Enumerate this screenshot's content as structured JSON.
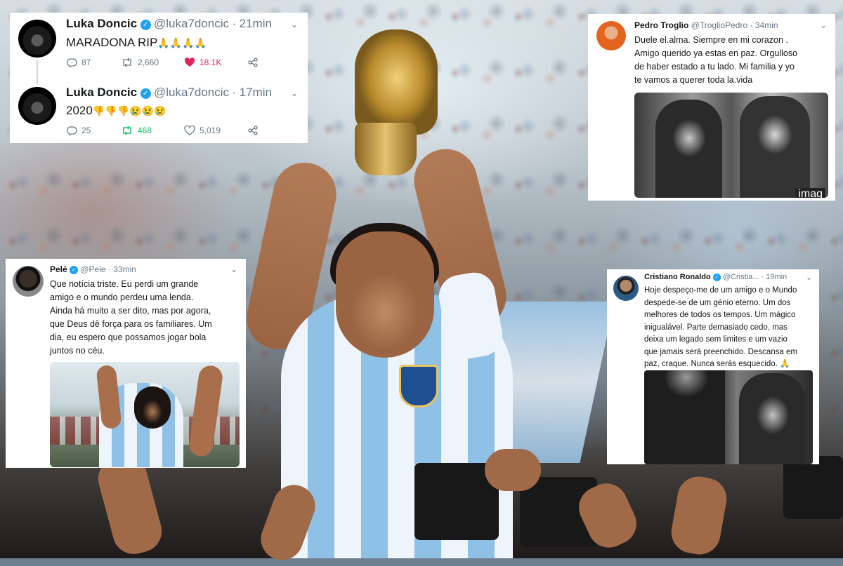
{
  "tweets": {
    "luka_1": {
      "name": "Luka Doncic",
      "handle": "@luka7doncic",
      "time": "21min",
      "text": "MARADONA RIP",
      "emoji": "🙏🙏🙏🙏",
      "replies": "87",
      "retweets": "2,660",
      "likes": "18.1K"
    },
    "luka_2": {
      "name": "Luka Doncic",
      "handle": "@luka7doncic",
      "time": "17min",
      "text": "2020",
      "emoji": "👎👎👎😢😢😢",
      "replies": "25",
      "retweets": "468",
      "likes": "5,019"
    },
    "troglio": {
      "name": "Pedro Troglio",
      "handle": "@TroglioPedro",
      "time": "34min",
      "lines": [
        "Duele el.alma. Siempre en mi corazon .",
        "Amigo querido ya estas en paz. Orgulloso",
        "de haber estado a tu lado. Mi familia y yo",
        "te vamos a querer toda la.vida"
      ],
      "photo_watermark": "imag"
    },
    "pele": {
      "name": "Pelé",
      "handle": "@Pele",
      "time": "33min",
      "lines": [
        "Que notícia triste. Eu perdi um grande",
        "amigo e o mundo perdeu uma lenda.",
        "Ainda há muito a ser dito, mas por agora,",
        "que Deus dê força para os familiares. Um",
        "dia, eu espero que possamos jogar bola",
        "juntos no céu."
      ]
    },
    "ronaldo": {
      "name": "Cristiano Ronaldo",
      "handle": "@Cristia...",
      "time": "19min",
      "lines": [
        "Hoje despeço-me de um amigo e o Mundo",
        "despede-se de um génio eterno. Um dos",
        "melhores de todos os tempos. Um mágico",
        "inigualável. Parte demasiado cedo, mas",
        "deixa um legado sem limites e um vazio",
        "que jamais será preenchido. Descansa em",
        "paz, craque. Nunca serás esquecido."
      ],
      "emoji": "🙏"
    }
  },
  "separator": "·",
  "colors": {
    "twitter_blue": "#1da1f2",
    "retweet_green": "#17bf63",
    "like_red": "#e0245e",
    "muted": "#657786"
  }
}
